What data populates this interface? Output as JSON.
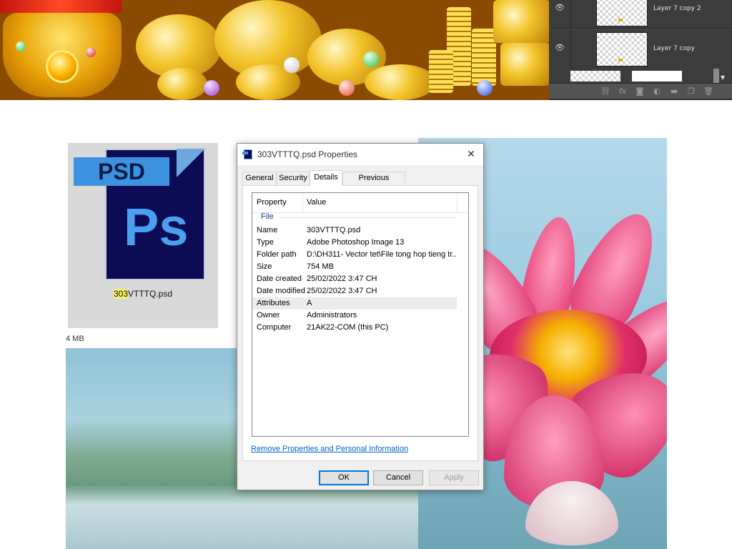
{
  "layers_panel": {
    "layers": [
      {
        "name": "Layer 7 copy 2",
        "visible": true
      },
      {
        "name": "Layer 7 copy",
        "visible": true
      }
    ]
  },
  "explorer": {
    "file_label_highlight": "303",
    "file_label_rest": "VTTTQ.psd",
    "icon_tag": "PSD",
    "icon_letters": "Ps",
    "size_hint": "4 MB"
  },
  "dialog": {
    "title": "303VTTTQ.psd Properties",
    "tabs": [
      {
        "label": "General",
        "active": false
      },
      {
        "label": "Security",
        "active": false
      },
      {
        "label": "Details",
        "active": true
      },
      {
        "label": "Previous Versions",
        "active": false
      }
    ],
    "columns": {
      "property": "Property",
      "value": "Value"
    },
    "group": "File",
    "rows": [
      {
        "key": "Name",
        "value": "303VTTTQ.psd"
      },
      {
        "key": "Type",
        "value": "Adobe Photoshop Image 13"
      },
      {
        "key": "Folder path",
        "value": "D:\\DH311- Vector tet\\File tong hop tieng tr..."
      },
      {
        "key": "Size",
        "value": "754 MB"
      },
      {
        "key": "Date created",
        "value": "25/02/2022 3:47 CH"
      },
      {
        "key": "Date modified",
        "value": "25/02/2022 3:47 CH"
      },
      {
        "key": "Attributes",
        "value": "A"
      },
      {
        "key": "Owner",
        "value": "Administrators"
      },
      {
        "key": "Computer",
        "value": "21AK22-COM (this PC)"
      }
    ],
    "remove_link": "Remove Properties and Personal Information",
    "buttons": {
      "ok": "OK",
      "cancel": "Cancel",
      "apply": "Apply"
    }
  },
  "colors": {
    "ps_panel": "#535353",
    "link": "#0066cc",
    "psd_blue": "#3d93e0",
    "psd_navy": "#0c0c55",
    "highlight": "#f8f06a"
  },
  "icons": [
    "eye-icon",
    "link-icon",
    "fx-icon",
    "mask-icon",
    "adjustment-icon",
    "folder-icon",
    "new-layer-icon",
    "trash-icon",
    "close-icon",
    "psd-file-icon"
  ]
}
